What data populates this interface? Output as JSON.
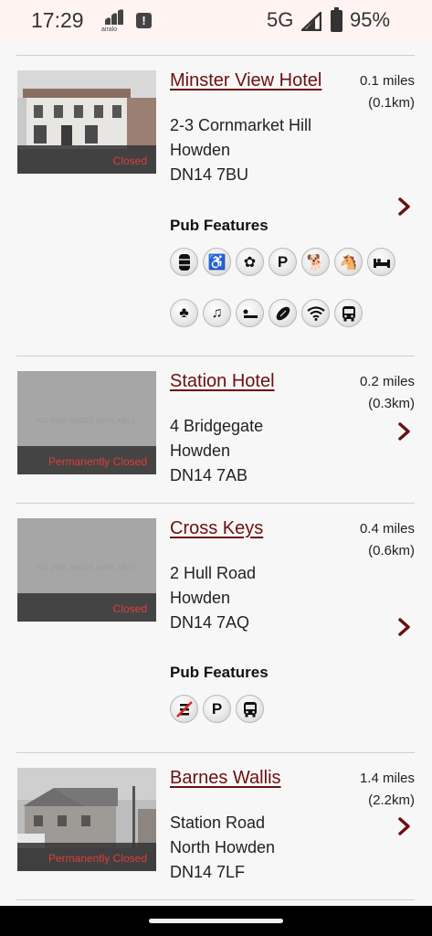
{
  "status_bar": {
    "time": "17:29",
    "carrier_app": "airalo",
    "network": "5G",
    "battery": "95%"
  },
  "pubs": [
    {
      "name": "Minster View Hotel",
      "distance_miles": "0.1 miles",
      "distance_km": "(0.1km)",
      "address": [
        "2-3 Cornmarket Hill",
        "Howden",
        "DN14 7BU"
      ],
      "status": "Closed",
      "image": "photo",
      "features_title": "Pub Features",
      "features": [
        [
          "barrel-icon",
          "wheelchair-icon",
          "flower-icon",
          "parking-icon",
          "dog-icon",
          "rocking-horse-icon",
          "bed-icon"
        ],
        [
          "club-icon",
          "music-icon",
          "sleep-icon",
          "rugby-ball-icon",
          "wifi-icon",
          "bus-icon"
        ]
      ]
    },
    {
      "name": "Station Hotel",
      "distance_miles": "0.2 miles",
      "distance_km": "(0.3km)",
      "address": [
        "4 Bridgegate",
        "Howden",
        "DN14 7AB"
      ],
      "status": "Permanently Closed",
      "image": "none",
      "no_image_text": "NO PUB IMAGE AVAILABLE"
    },
    {
      "name": "Cross Keys",
      "distance_miles": "0.4 miles",
      "distance_km": "(0.6km)",
      "address": [
        "2 Hull Road",
        "Howden",
        "DN14 7AQ"
      ],
      "status": "Closed",
      "image": "none",
      "no_image_text": "NO PUB IMAGE AVAILABLE",
      "features_title": "Pub Features",
      "features": [
        [
          "no-smoking-icon",
          "parking-icon",
          "bus-icon"
        ]
      ]
    },
    {
      "name": "Barnes Wallis",
      "distance_miles": "1.4 miles",
      "distance_km": "(2.2km)",
      "address": [
        "Station Road",
        "North Howden",
        "DN14 7LF"
      ],
      "status": "Permanently Closed",
      "image": "photo"
    }
  ],
  "colors": {
    "pub_name": "#6b0f0f",
    "closed_text": "#e23b3b",
    "status_bar_bg": "#fff4f1"
  }
}
